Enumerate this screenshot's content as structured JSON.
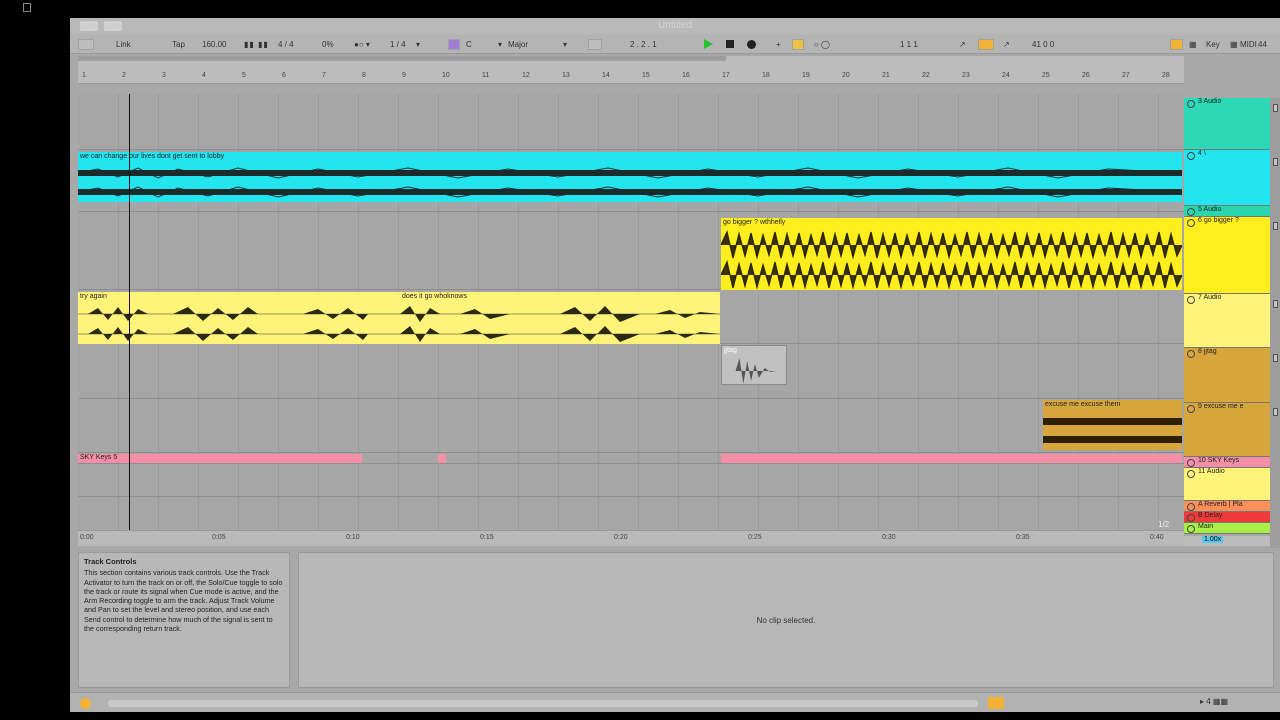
{
  "window": {
    "title": "Untitled"
  },
  "control_bar": {
    "link": "Link",
    "tap": "Tap",
    "tempo": "160.00",
    "time_signature": "4 / 4",
    "groove_amount": "0%",
    "quantization": "1 / 4",
    "key": "C",
    "scale": "Major",
    "song_position": "2 .  2 .  1",
    "loop_start": "1     1     1",
    "loop_length": "41     0     0",
    "key_button": "Key",
    "midi_button": "MIDI",
    "cpu": "44"
  },
  "ruler": {
    "bars": [
      "1",
      "2",
      "3",
      "4",
      "5",
      "6",
      "7",
      "8",
      "9",
      "10",
      "11",
      "12",
      "13",
      "14",
      "15",
      "16",
      "17",
      "18",
      "19",
      "20",
      "21",
      "22",
      "23",
      "24",
      "25",
      "26",
      "27",
      "28"
    ]
  },
  "timeline": {
    "labels": [
      "0:00",
      "0:05",
      "0:10",
      "0:15",
      "0:20",
      "0:25",
      "0:30",
      "0:35",
      "0:40"
    ]
  },
  "clips": [
    {
      "name": "we can change our lives dont get sent to lobby",
      "color": "#22e5f0"
    },
    {
      "name": "go bigger ? wthhelly",
      "color": "#ffee1e"
    },
    {
      "name": "try again",
      "color": "#fff37a"
    },
    {
      "name": "does it go whoknows",
      "color": "#fff37a"
    },
    {
      "name": "jjtag",
      "color": "#c0c0c0"
    },
    {
      "name": "excuse me excuse them",
      "color": "#d6a63c"
    },
    {
      "name": "SKY Keys 5",
      "color": "#f58fa8"
    }
  ],
  "tracks": [
    {
      "name": "3 Audio",
      "color": "#2cd8b5"
    },
    {
      "name": "4 \\",
      "color": "#22e5f0"
    },
    {
      "name": "5 Audio",
      "color": "#2ad6b0"
    },
    {
      "name": "6 go bigger ?",
      "color": "#ffee1e"
    },
    {
      "name": "7 Audio",
      "color": "#fff37a"
    },
    {
      "name": "8 jjtag",
      "color": "#d6a63c"
    },
    {
      "name": "9 excuse me e",
      "color": "#d6a63c"
    },
    {
      "name": "10 SKY Keys",
      "color": "#f58fa8"
    },
    {
      "name": "11 Audio",
      "color": "#fff37a"
    },
    {
      "name": "A Reverb | Pla",
      "color": "#ff8f5a"
    },
    {
      "name": "B Delay",
      "color": "#f03a3a"
    },
    {
      "name": "Main",
      "color": "#a9f044"
    }
  ],
  "zoom": "1.00x",
  "page_counter": "1/2",
  "info_view": {
    "title": "Track Controls",
    "body": "This section contains various track controls. Use the Track Activator to turn the track on or off, the Solo/Cue toggle to solo the track or route its signal when Cue mode is active, and the Arm Recording toggle to arm the track. Adjust Track Volume and Pan to set the level and stereo position, and use each Send control to determine how much of the signal is sent to the corresponding return track."
  },
  "detail_view": {
    "message": "No clip selected."
  }
}
